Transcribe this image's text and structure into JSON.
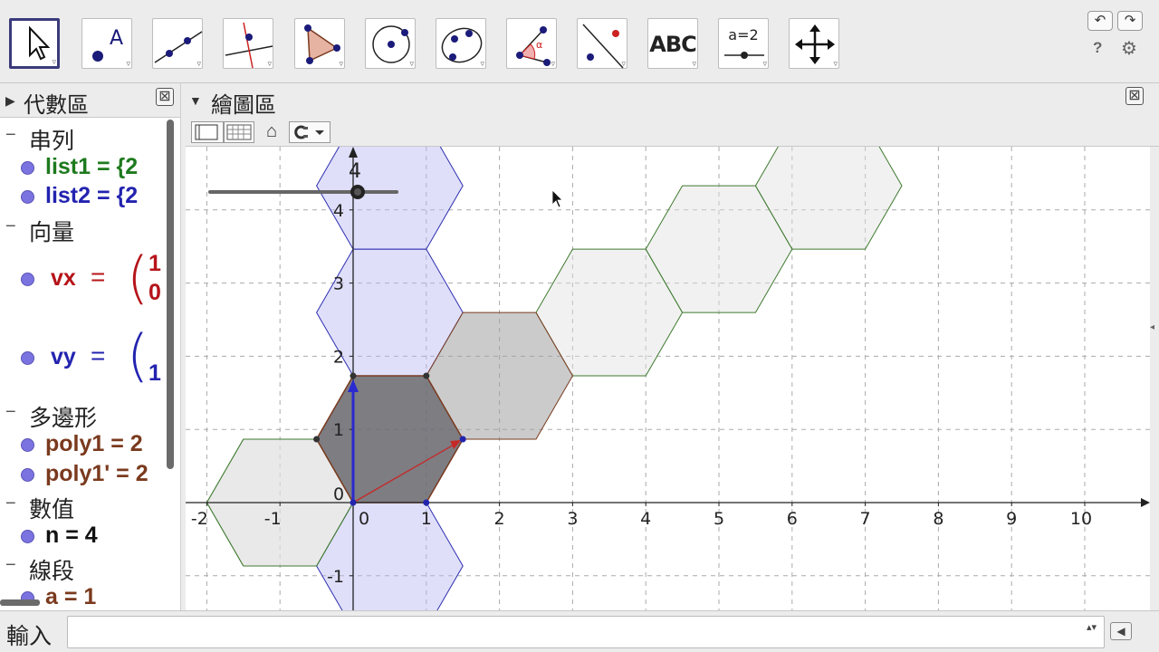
{
  "toolbar": {
    "text_tool_label": "ABC",
    "slider_tool_label": "a=2",
    "undo": "↶",
    "redo": "↷",
    "help": "?",
    "settings": "⚙"
  },
  "algebra": {
    "title": "代數區",
    "close": "⊠",
    "categories": {
      "lists": "串列",
      "vectors": "向量",
      "polygons": "多邊形",
      "numbers": "數值",
      "segments": "線段"
    },
    "items": {
      "list1": "list1 = {2",
      "list2": "list2 = {2",
      "vx_name": "vx",
      "vy_name": "vy",
      "eq": "=",
      "vx_top": "1",
      "vx_bottom": "0",
      "vy_bottom": "1",
      "poly1": "poly1 = 2",
      "poly1p": "poly1' = 2",
      "n": "n = 4",
      "a": "a = 1"
    },
    "colors": {
      "list1": "#1e7a1e",
      "list2": "#2323b0",
      "vx": "#b5141a",
      "vy": "#2323b0",
      "poly": "#7a3a1e",
      "n": "#111111",
      "a": "#7a3a1e"
    }
  },
  "graphics": {
    "title": "繪圖區",
    "close": "⊠",
    "home": "⌂",
    "slider_value": "4",
    "x_ticks": [
      "-2",
      "-1",
      "0",
      "1",
      "2",
      "3",
      "4",
      "5",
      "6",
      "7",
      "8",
      "9",
      "10"
    ],
    "y_ticks": [
      "1",
      "2",
      "3",
      "4",
      "-1"
    ],
    "origin": "0"
  },
  "inputbar": {
    "label": "輸入",
    "value": "",
    "spin": "▴▾"
  }
}
